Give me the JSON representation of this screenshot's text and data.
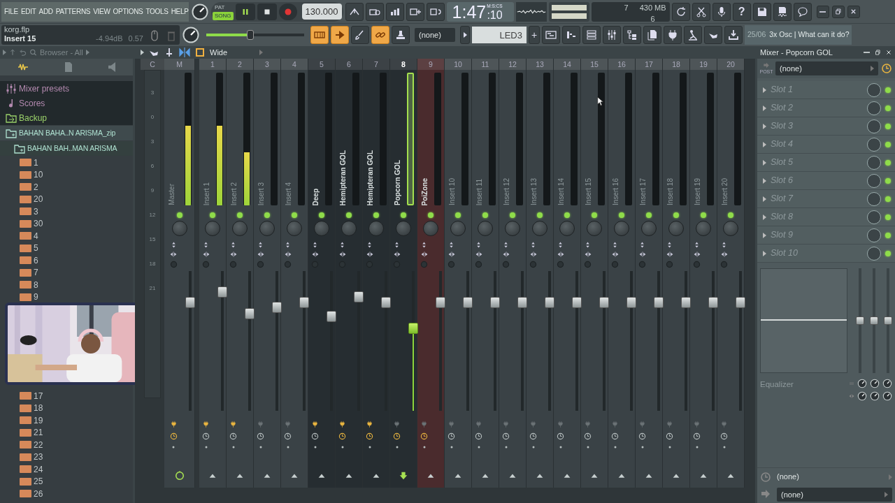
{
  "menu": [
    "FILE",
    "EDIT",
    "ADD",
    "PATTERNS",
    "VIEW",
    "OPTIONS",
    "TOOLS",
    "HELP"
  ],
  "transport": {
    "modes": [
      {
        "label": "PAT",
        "selected": false
      },
      {
        "label": "SONG",
        "selected": true
      }
    ],
    "playing": true,
    "tempo": "130.000"
  },
  "clock": {
    "time": "1:47",
    "centis": ":10",
    "format": "M:S:CS"
  },
  "cpu": {
    "polyphony": "7",
    "memory": "430 MB",
    "voices": "6"
  },
  "help_label": "?",
  "project": {
    "file": "korg.flp",
    "hint": "Insert 15",
    "gain": "-4.94dB",
    "value": "0.57"
  },
  "master_volume": {
    "level": 0.45
  },
  "tools": [
    {
      "kind": "piano",
      "on": true
    },
    {
      "kind": "arrow",
      "on": true
    },
    {
      "kind": "brush",
      "on": false
    },
    {
      "kind": "link",
      "on": true
    },
    {
      "kind": "stamp",
      "on": false
    }
  ],
  "pattern": "(none)",
  "led_display": "LED3",
  "led_plus": "+",
  "hint_bar": {
    "date": "25/06",
    "text": "3x Osc | What can it do?"
  },
  "browser": {
    "title": "Browser - All",
    "tree": [
      {
        "label": "Mixer presets",
        "kind": "mixer"
      },
      {
        "label": "Scores",
        "kind": "note"
      },
      {
        "label": "Backup",
        "kind": "backup"
      },
      {
        "label": "BAHAN BAHA..N ARISMA_zip",
        "kind": "folder",
        "children": [
          {
            "label": "BAHAN BAH..MAN ARISMA",
            "kind": "folder",
            "children": [
              {
                "label": "1",
                "kind": "mp3"
              },
              {
                "label": "10",
                "kind": "mp3"
              },
              {
                "label": "2",
                "kind": "mp3"
              },
              {
                "label": "20",
                "kind": "mp3"
              },
              {
                "label": "3",
                "kind": "mp3"
              },
              {
                "label": "30",
                "kind": "mp3"
              },
              {
                "label": "4",
                "kind": "mp3"
              },
              {
                "label": "5",
                "kind": "mp3"
              },
              {
                "label": "6",
                "kind": "mp3"
              },
              {
                "label": "7",
                "kind": "mp3"
              },
              {
                "label": "8",
                "kind": "mp3"
              },
              {
                "label": "9",
                "kind": "mp3"
              },
              {
                "label": "17",
                "kind": "mp3"
              },
              {
                "label": "18",
                "kind": "mp3"
              },
              {
                "label": "19",
                "kind": "mp3"
              },
              {
                "label": "21",
                "kind": "mp3"
              },
              {
                "label": "22",
                "kind": "mp3"
              },
              {
                "label": "23",
                "kind": "mp3"
              },
              {
                "label": "24",
                "kind": "mp3"
              },
              {
                "label": "25",
                "kind": "mp3"
              },
              {
                "label": "26",
                "kind": "mp3"
              }
            ]
          }
        ]
      }
    ]
  },
  "mixer": {
    "stereo_label": "Wide",
    "scale_header": "C",
    "scale": [
      "3",
      "0",
      "3",
      "6",
      "9",
      "12",
      "15",
      "18",
      "21"
    ],
    "tracks": [
      {
        "number": "M",
        "name": "Master",
        "kind": "master",
        "color": "#3a4246",
        "selected": false,
        "meter": {
          "level": 0.6
        },
        "fader": {
          "level": 0.8
        },
        "plug": true,
        "clock": true
      },
      {
        "number": "1",
        "name": "Insert 1",
        "kind": "insert",
        "color": "#3a4246",
        "selected": false,
        "meter": {
          "level": 0.6
        },
        "fader": {
          "level": 0.88
        },
        "plug": true,
        "clock": false
      },
      {
        "number": "2",
        "name": "Insert 2",
        "kind": "insert",
        "color": "#3a4246",
        "selected": false,
        "meter": {
          "level": 0.4
        },
        "fader": {
          "level": 0.71
        },
        "plug": true,
        "clock": false
      },
      {
        "number": "3",
        "name": "Insert 3",
        "kind": "insert",
        "color": "#3a4246",
        "selected": false,
        "meter": {
          "level": 0
        },
        "fader": {
          "level": 0.76
        },
        "plug": false,
        "clock": false
      },
      {
        "number": "4",
        "name": "Insert 4",
        "kind": "insert",
        "color": "#3a4246",
        "selected": false,
        "meter": {
          "level": 0
        },
        "fader": {
          "level": 0.8
        },
        "plug": false,
        "clock": false
      },
      {
        "number": "5",
        "name": "Deep",
        "kind": "insert",
        "color": "#262d31",
        "selected": false,
        "meter": {
          "level": 0
        },
        "fader": {
          "level": 0.69
        },
        "plug": true,
        "clock": false
      },
      {
        "number": "6",
        "name": "Hemipteran GOL",
        "kind": "insert",
        "color": "#262d31",
        "selected": false,
        "meter": {
          "level": 0
        },
        "fader": {
          "level": 0.84
        },
        "plug": true,
        "clock": true
      },
      {
        "number": "7",
        "name": "Hemipteran GOL",
        "kind": "insert",
        "color": "#262d31",
        "selected": false,
        "meter": {
          "level": 0
        },
        "fader": {
          "level": 0.8
        },
        "plug": true,
        "clock": true
      },
      {
        "number": "8",
        "name": "Popcorn GOL",
        "kind": "insert",
        "color": "#262d31",
        "selected": true,
        "meter": {
          "level": 0
        },
        "fader": {
          "level": 0.6
        },
        "plug": false,
        "clock": true
      },
      {
        "number": "9",
        "name": "PoiZone",
        "kind": "insert",
        "color": "#4a2b2d",
        "selected": false,
        "meter": {
          "level": 0
        },
        "fader": {
          "level": 0.8
        },
        "plug": false,
        "clock": true
      },
      {
        "number": "10",
        "name": "Insert 10",
        "kind": "insert",
        "color": "#3a4246",
        "selected": false,
        "meter": {
          "level": 0
        },
        "fader": {
          "level": 0.8
        },
        "plug": false,
        "clock": false
      },
      {
        "number": "11",
        "name": "Insert 11",
        "kind": "insert",
        "color": "#3a4246",
        "selected": false,
        "meter": {
          "level": 0
        },
        "fader": {
          "level": 0.8
        },
        "plug": false,
        "clock": false
      },
      {
        "number": "12",
        "name": "Insert 12",
        "kind": "insert",
        "color": "#3a4246",
        "selected": false,
        "meter": {
          "level": 0
        },
        "fader": {
          "level": 0.8
        },
        "plug": false,
        "clock": false
      },
      {
        "number": "13",
        "name": "Insert 13",
        "kind": "insert",
        "color": "#3a4246",
        "selected": false,
        "meter": {
          "level": 0
        },
        "fader": {
          "level": 0.8
        },
        "plug": false,
        "clock": false
      },
      {
        "number": "14",
        "name": "Insert 14",
        "kind": "insert",
        "color": "#3a4246",
        "selected": false,
        "meter": {
          "level": 0
        },
        "fader": {
          "level": 0.8
        },
        "plug": false,
        "clock": false
      },
      {
        "number": "15",
        "name": "Insert 15",
        "kind": "insert",
        "color": "#3a4246",
        "selected": false,
        "meter": {
          "level": 0
        },
        "fader": {
          "level": 0.8
        },
        "plug": false,
        "clock": false
      },
      {
        "number": "16",
        "name": "Insert 16",
        "kind": "insert",
        "color": "#3a4246",
        "selected": false,
        "meter": {
          "level": 0
        },
        "fader": {
          "level": 0.8
        },
        "plug": false,
        "clock": false
      },
      {
        "number": "17",
        "name": "Insert 17",
        "kind": "insert",
        "color": "#3a4246",
        "selected": false,
        "meter": {
          "level": 0
        },
        "fader": {
          "level": 0.8
        },
        "plug": false,
        "clock": false
      },
      {
        "number": "18",
        "name": "Insert 18",
        "kind": "insert",
        "color": "#3a4246",
        "selected": false,
        "meter": {
          "level": 0
        },
        "fader": {
          "level": 0.8
        },
        "plug": false,
        "clock": false
      },
      {
        "number": "19",
        "name": "Insert 19",
        "kind": "insert",
        "color": "#3a4246",
        "selected": false,
        "meter": {
          "level": 0
        },
        "fader": {
          "level": 0.8
        },
        "plug": false,
        "clock": false
      },
      {
        "number": "20",
        "name": "Insert 20",
        "kind": "insert",
        "color": "#3a4246",
        "selected": false,
        "meter": {
          "level": 0
        },
        "fader": {
          "level": 0.8
        },
        "plug": false,
        "clock": false
      }
    ]
  },
  "panel": {
    "title": "Mixer - Popcorn GOL",
    "post_label": "POST",
    "input": "(none)",
    "slots": [
      {
        "label": "Slot 1",
        "on": true
      },
      {
        "label": "Slot 2",
        "on": true
      },
      {
        "label": "Slot 3",
        "on": true
      },
      {
        "label": "Slot 4",
        "on": true
      },
      {
        "label": "Slot 5",
        "on": true
      },
      {
        "label": "Slot 6",
        "on": true
      },
      {
        "label": "Slot 7",
        "on": true
      },
      {
        "label": "Slot 8",
        "on": true
      },
      {
        "label": "Slot 9",
        "on": true
      },
      {
        "label": "Slot 10",
        "on": true
      }
    ],
    "eq_bands": [
      {
        "level": 0.5
      },
      {
        "level": 0.5
      },
      {
        "level": 0.5
      }
    ],
    "eq_label": "Equalizer",
    "sidechain": "(none)",
    "output": "(none)"
  }
}
